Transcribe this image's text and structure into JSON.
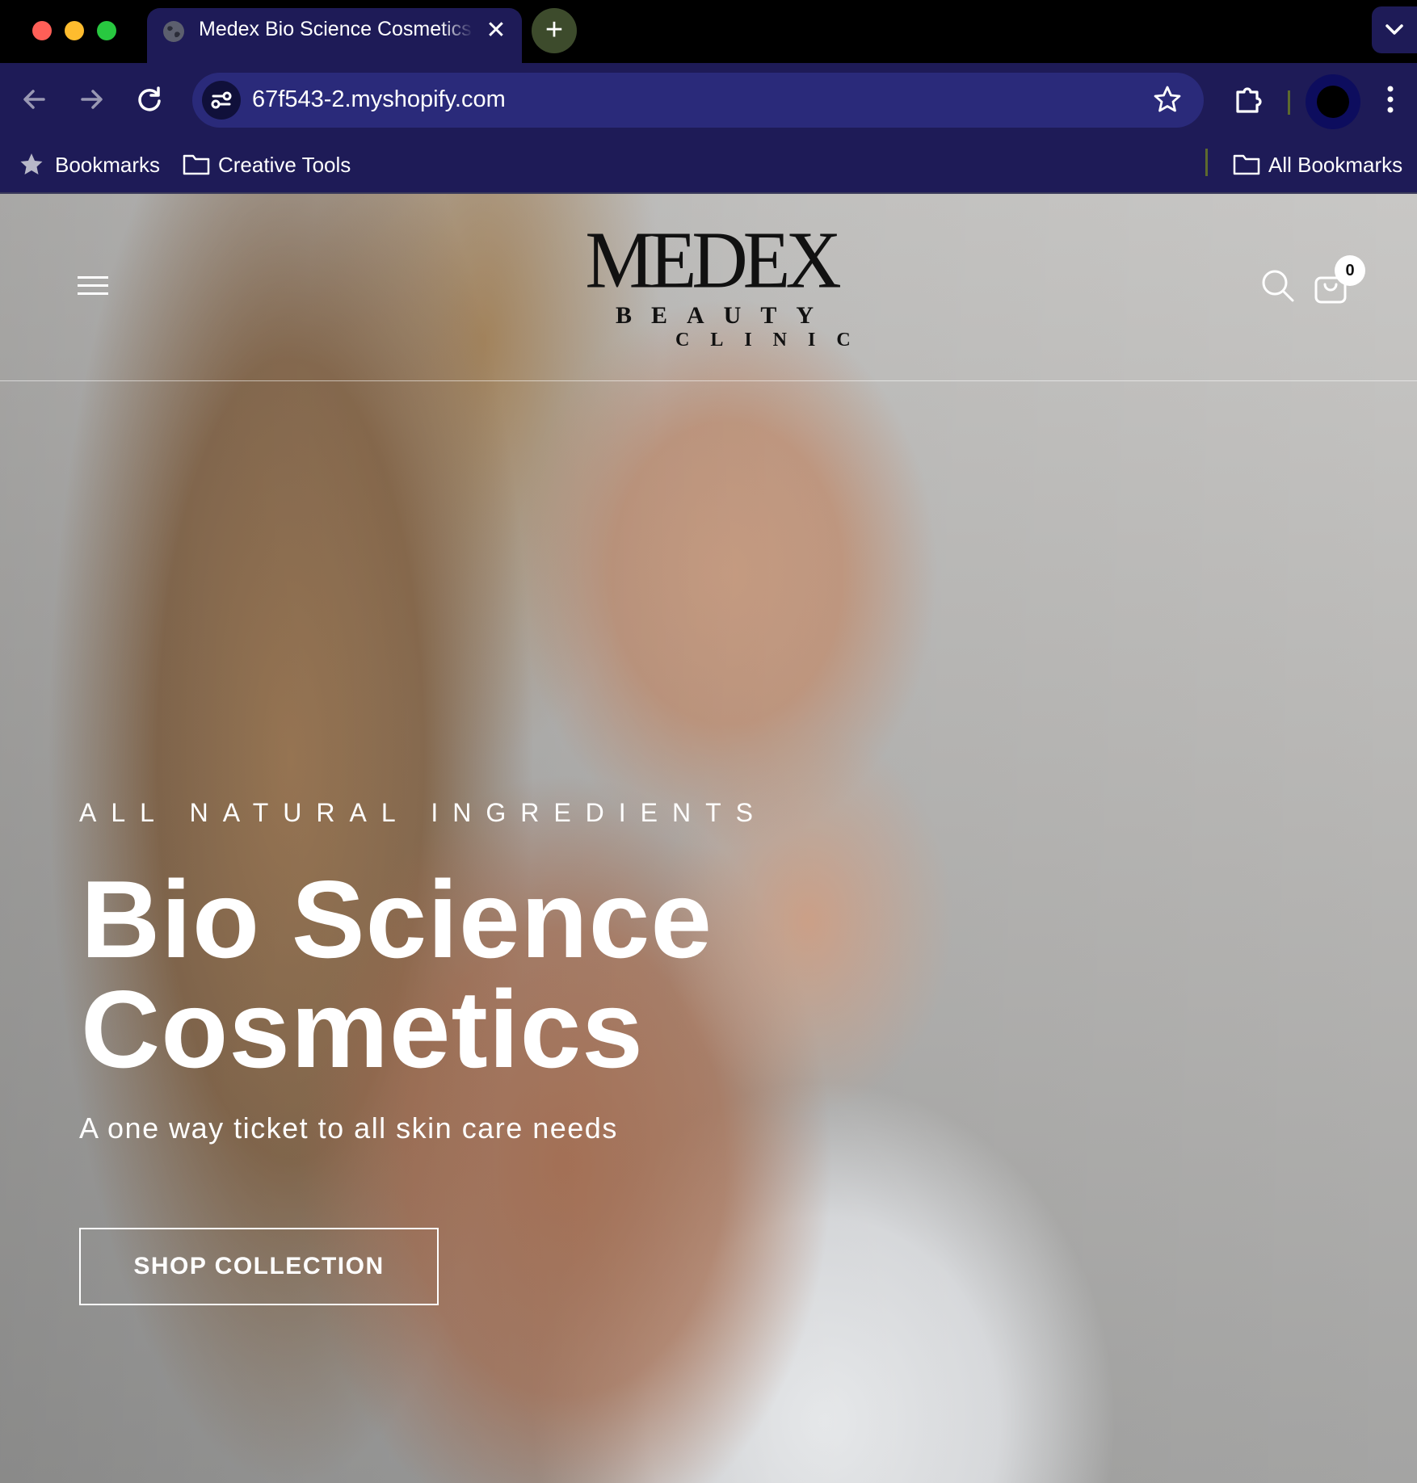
{
  "browser": {
    "tab_title": "Medex Bio Science Cosmetics",
    "new_tab_label": "+",
    "tab_close_label": "✕",
    "url": "67f543-2.myshopify.com",
    "bookmarks": [
      {
        "label": "Bookmarks",
        "icon": "star-icon"
      },
      {
        "label": "Creative Tools",
        "icon": "folder-icon"
      }
    ],
    "all_bookmarks": "All Bookmarks",
    "colors": {
      "tabstrip": "#000000",
      "toolbar": "#1e1b57",
      "omnibox": "#2a2a7a"
    }
  },
  "site": {
    "logo": {
      "main": "MEDEX",
      "line2": "BEAUTY",
      "line3": "CLINIC"
    },
    "cart_count": "0",
    "icons": [
      "menu-icon",
      "search-icon",
      "cart-icon"
    ]
  },
  "hero": {
    "eyebrow": "ALL NATURAL INGREDIENTS",
    "title_line1": "Bio Science",
    "title_line2": "Cosmetics",
    "subtitle": "A one way ticket to all skin care needs",
    "cta_label": "SHOP COLLECTION"
  }
}
